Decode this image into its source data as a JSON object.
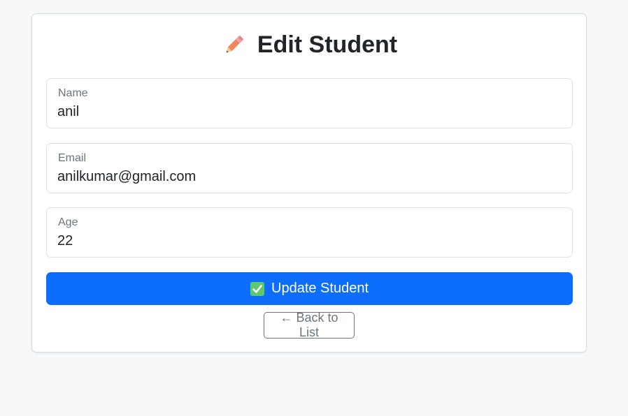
{
  "page": {
    "title": "Edit Student",
    "title_icon": "pencil-icon"
  },
  "form": {
    "fields": [
      {
        "label": "Name",
        "value": "anil"
      },
      {
        "label": "Email",
        "value": "anilkumar@gmail.com"
      },
      {
        "label": "Age",
        "value": "22"
      }
    ],
    "submit_label": "Update Student",
    "submit_icon": "check-box-icon",
    "back_label": "← Back to List"
  },
  "colors": {
    "primary": "#0d6efd",
    "secondary": "#6c757d",
    "background": "#f7f8fa"
  }
}
